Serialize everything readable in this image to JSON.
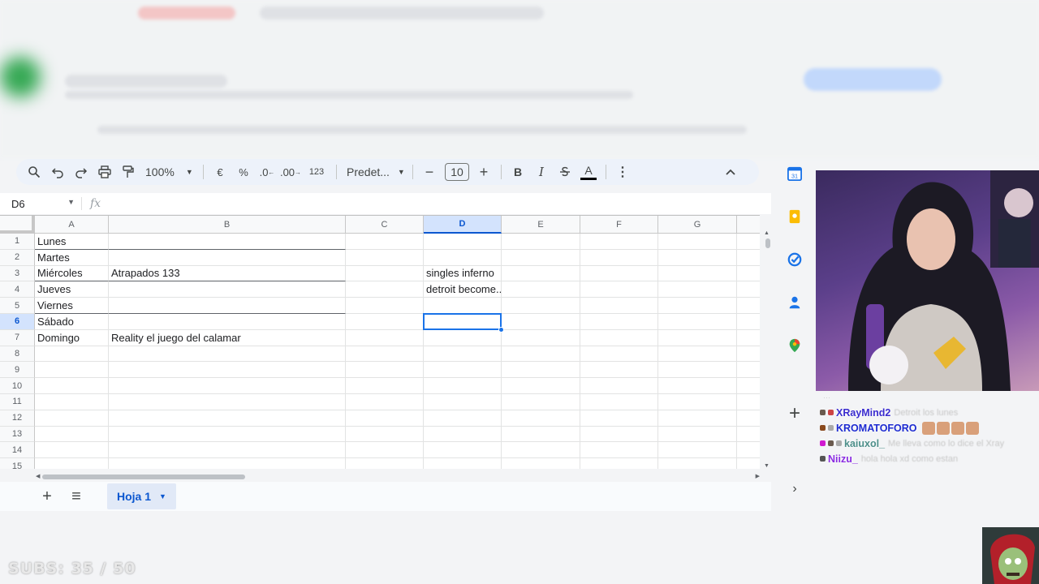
{
  "toolbar": {
    "zoom": "100%",
    "currency": "€",
    "percent": "%",
    "dec_decrease": ".0",
    "dec_increase": ".00",
    "number_format": "123",
    "font": "Predet...",
    "font_size": "10",
    "bold": "B",
    "italic": "I",
    "text_color": "A"
  },
  "formula_bar": {
    "cell_ref": "D6",
    "fx": "fx"
  },
  "columns": [
    "A",
    "B",
    "C",
    "D",
    "E",
    "F",
    "G"
  ],
  "selected_column": "D",
  "rows": [
    "1",
    "2",
    "3",
    "4",
    "5",
    "6",
    "7",
    "8",
    "9",
    "10",
    "11",
    "12",
    "13",
    "14",
    "15"
  ],
  "selected_row": "6",
  "cells": {
    "A1": "Lunes",
    "A2": "Martes",
    "A3": "Miércoles",
    "B3": "Atrapados 133",
    "D3": "singles inferno",
    "A4": "Jueves",
    "D4": "detroit become...",
    "A5": "Viernes",
    "A6": "Sábado",
    "A7": "Domingo",
    "B7": "Reality el juego del calamar"
  },
  "sheet_tabs": [
    {
      "label": "Hoja 1",
      "active": true
    }
  ],
  "side_panel_icons": [
    "calendar-icon",
    "keep-icon",
    "tasks-icon",
    "contacts-icon",
    "maps-icon",
    "add-icon",
    "expand-icon"
  ],
  "calendar_day": "31",
  "chat": [
    {
      "user": "XRayMind2",
      "color": "#3a2ccf",
      "message": "Detroit los lunes",
      "emotes": 0
    },
    {
      "user": "KROMATOFORO",
      "color": "#1d2bd1",
      "message": "",
      "emotes": 4
    },
    {
      "user": "kaiuxol_",
      "color": "#4d8f8a",
      "message": "Me lleva como lo dice el Xray",
      "emotes": 0
    },
    {
      "user": "Niizu_",
      "color": "#8a2be2",
      "message": "hola hola xd como estan",
      "emotes": 0
    }
  ],
  "subs_counter": "SUBS: 35 / 50"
}
